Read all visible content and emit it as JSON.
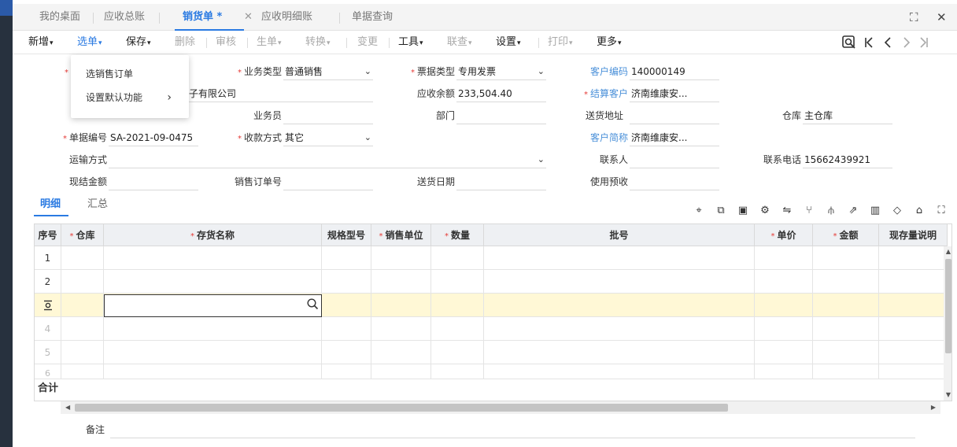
{
  "tabs": [
    {
      "label": "我的桌面"
    },
    {
      "label": "应收总账"
    },
    {
      "label": "销货单 *",
      "active": true
    },
    {
      "label": "应收明细账"
    },
    {
      "label": "单据查询"
    }
  ],
  "tab_close": "✕",
  "window_controls": {
    "expand": "⛶",
    "close": "✕"
  },
  "toolbar": {
    "items": [
      "新增",
      "选单",
      "保存",
      "删除",
      "审核",
      "生单",
      "转换",
      "变更",
      "工具",
      "联查",
      "设置",
      "打印",
      "更多"
    ]
  },
  "dropdown_menu": {
    "items": [
      "选销售订单",
      "设置默认功能"
    ]
  },
  "form": {
    "customer_name_value": "子有限公司",
    "business_type": {
      "label": "业务类型",
      "value": "普通销售"
    },
    "invoice_type": {
      "label": "票据类型",
      "value": "专用发票"
    },
    "customer_code": {
      "label": "客户编码",
      "value": "140000149"
    },
    "receivable_balance": {
      "label": "应收余额",
      "value": "233,504.40"
    },
    "settle_customer": {
      "label": "结算客户",
      "value": "济南维康安..."
    },
    "salesman": {
      "label": "业务员",
      "value": ""
    },
    "department": {
      "label": "部门",
      "value": ""
    },
    "delivery_address": {
      "label": "送货地址",
      "value": ""
    },
    "warehouse": {
      "label": "仓库",
      "value": "主仓库"
    },
    "doc_number": {
      "label": "单据编号",
      "value": "SA-2021-09-0475"
    },
    "payment_method": {
      "label": "收款方式",
      "value": "其它"
    },
    "customer_short": {
      "label": "客户简称",
      "value": "济南维康安..."
    },
    "transport": {
      "label": "运输方式",
      "value": ""
    },
    "contact": {
      "label": "联系人",
      "value": ""
    },
    "phone": {
      "label": "联系电话",
      "value": "15662439921"
    },
    "cash_amount": {
      "label": "现结金额",
      "value": ""
    },
    "sales_order_no": {
      "label": "销售订单号",
      "value": ""
    },
    "delivery_date": {
      "label": "送货日期",
      "value": ""
    },
    "use_prepay": {
      "label": "使用预收",
      "value": ""
    }
  },
  "detail_tabs": [
    "明细",
    "汇总"
  ],
  "grid": {
    "columns": [
      "序号",
      "仓库",
      "存货名称",
      "规格型号",
      "销售单位",
      "数量",
      "批号",
      "单价",
      "金额",
      "现存量说明"
    ],
    "rows": [
      "1",
      "2",
      "",
      "4",
      "5",
      "6"
    ],
    "sum_label": "合计"
  },
  "remark": {
    "label": "备注",
    "value": ""
  },
  "colors": {
    "accent": "#2a7ae2",
    "required": "#e53935",
    "selected_row": "#fff8d6"
  }
}
